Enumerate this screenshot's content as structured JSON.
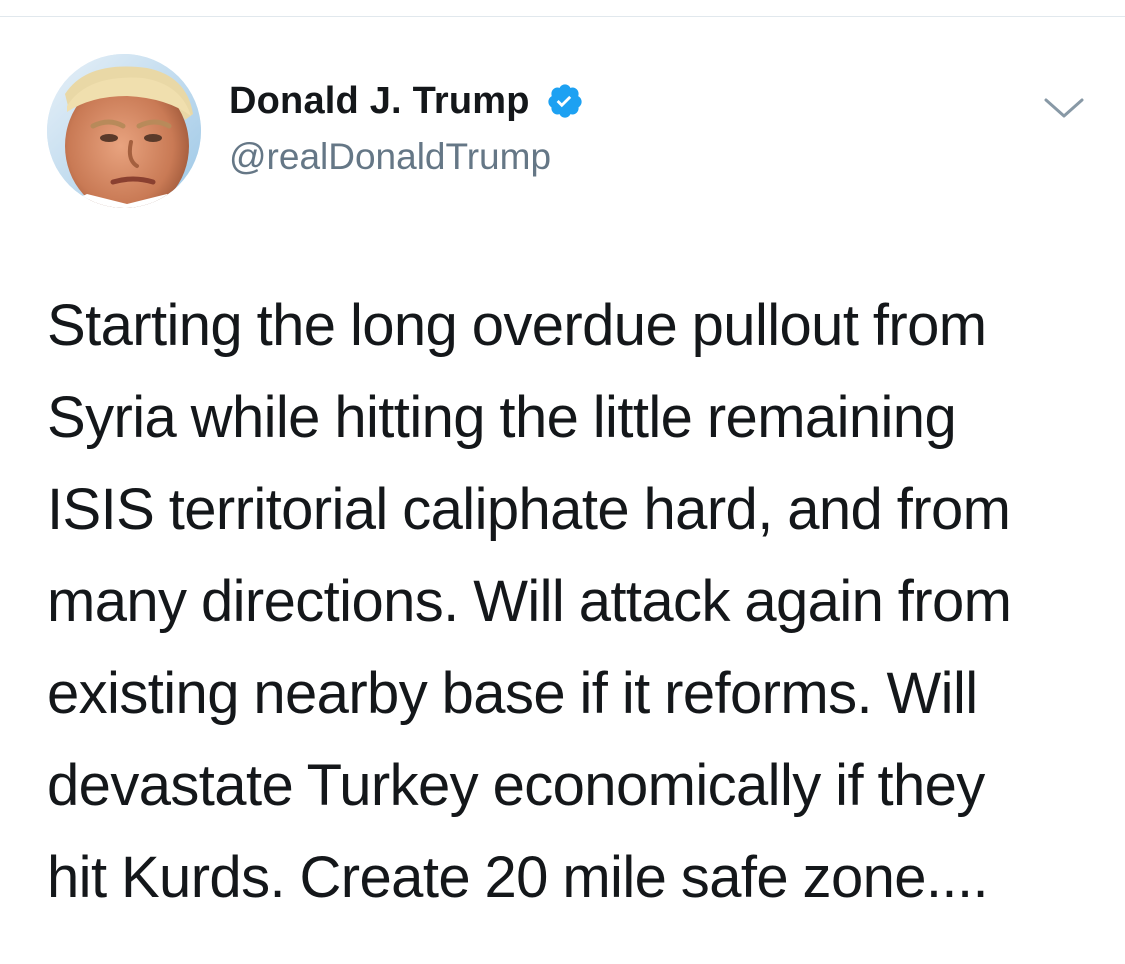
{
  "tweet": {
    "author": {
      "display_name": "Donald J. Trump",
      "handle": "@realDonaldTrump",
      "verified": true,
      "verified_icon": "verified-badge-icon",
      "avatar_icon": "profile-photo"
    },
    "menu_icon": "chevron-down-icon",
    "text_lines": [
      "Starting the long overdue pullout from",
      "Syria while hitting the little remaining",
      "ISIS territorial caliphate hard, and from",
      "many directions. Will attack again from",
      "existing nearby base if it reforms. Will",
      "devastate Turkey economically if they",
      "hit Kurds. Create 20 mile safe zone...."
    ]
  },
  "colors": {
    "text": "#14171a",
    "secondary_text": "#657786",
    "verified_blue": "#1da1f2",
    "divider": "#e1e8ed",
    "chevron": "#8899a6"
  }
}
